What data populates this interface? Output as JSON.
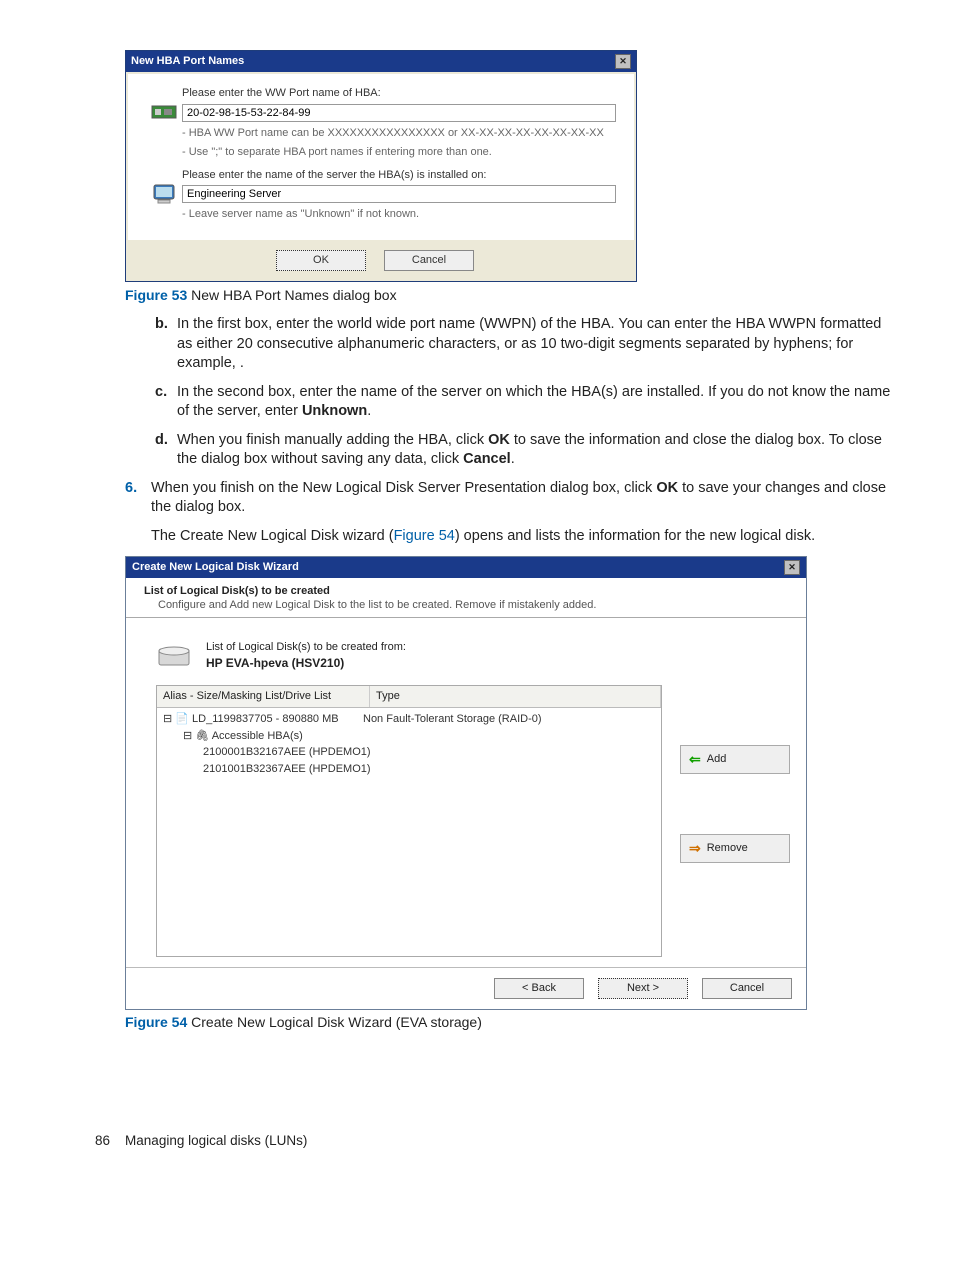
{
  "dlg1": {
    "title": "New HBA Port Names",
    "label1": "Please enter the WW Port name of HBA:",
    "input1": "20-02-98-15-53-22-84-99",
    "note1a": "- HBA WW Port name can be XXXXXXXXXXXXXXXX or XX-XX-XX-XX-XX-XX-XX-XX",
    "note1b": "- Use \";\" to separate HBA port names if entering more than one.",
    "label2": "Please enter the name of the server the HBA(s) is installed on:",
    "input2": "Engineering Server",
    "note2": "- Leave server name as \"Unknown\" if not known.",
    "ok": "OK",
    "cancel": "Cancel"
  },
  "cap53": {
    "label": "Figure 53",
    "text": " New HBA Port Names dialog box"
  },
  "list": {
    "b1": "In the first box, enter the world wide port name (WWPN) of the HBA. You can enter the HBA WWPN formatted as either 20 consecutive alphanumeric characters, or as 10 two-digit segments separated by hyphens; for example, ",
    "b2": ".",
    "c1": "In the second box, enter the name of the server on which the HBA(s) are installed. If you do not know the name of the server, enter ",
    "c_bold": "Unknown",
    "c2": ".",
    "d1": "When you finish manually adding the HBA, click ",
    "d_ok": "OK",
    "d2": " to save the information and close the dialog box. To close the dialog box without saving any data, click ",
    "d_cancel": "Cancel",
    "d3": "."
  },
  "step6": {
    "a": "When you finish on the New Logical Disk Server Presentation dialog box, click ",
    "ok": "OK",
    "b": " to save your changes and close the dialog box."
  },
  "para2": {
    "a": "The Create New Logical Disk wizard (",
    "link": "Figure 54",
    "b": ") opens and lists the information for the new logical disk."
  },
  "dlg2": {
    "title": "Create New Logical Disk Wizard",
    "head_title": "List of Logical Disk(s) to be created",
    "head_sub": "Configure and Add new Logical Disk to the list to be created. Remove if mistakenly added.",
    "info1": "List of Logical Disk(s) to be created from:",
    "info2": "HP EVA-hpeva (HSV210)",
    "col1": "Alias - Size/Masking List/Drive List",
    "col2": "Type",
    "row1a": "LD_1199837705 - 890880 MB",
    "row1b": "Non Fault-Tolerant Storage (RAID-0)",
    "row2": "Accessible HBA(s)",
    "row3": "2100001B32167AEE (HPDEMO1)",
    "row4": "2101001B32367AEE (HPDEMO1)",
    "add": "Add",
    "remove": "Remove",
    "back": "< Back",
    "next": "Next >",
    "cancel": "Cancel"
  },
  "cap54": {
    "label": "Figure 54",
    "text": " Create New Logical Disk Wizard (EVA storage)"
  },
  "footer": {
    "num": "86",
    "text": "Managing logical disks (LUNs)"
  }
}
